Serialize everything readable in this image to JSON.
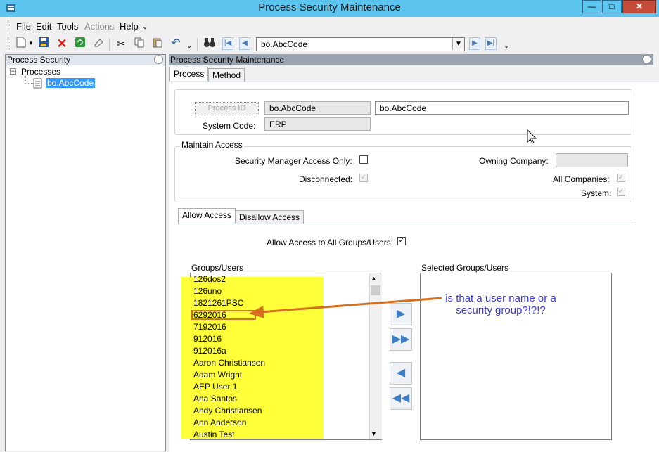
{
  "window": {
    "title": "Process Security Maintenance",
    "controls": {
      "minimize": "—",
      "maximize": "□",
      "close": "✕"
    }
  },
  "menu": {
    "items": [
      {
        "label": "File"
      },
      {
        "label": "Edit"
      },
      {
        "label": "Tools"
      },
      {
        "label": "Actions",
        "disabled": true
      },
      {
        "label": "Help"
      }
    ]
  },
  "toolbar": {
    "record_value": "bo.AbcCode"
  },
  "left_panel": {
    "header": "Process Security",
    "tree": {
      "root": "Processes",
      "child": "bo.AbcCode"
    }
  },
  "right_panel": {
    "header": "Process Security Maintenance",
    "tabs": [
      "Process",
      "Method"
    ],
    "process_id": {
      "button": "Process ID",
      "value": "bo.AbcCode",
      "description": "bo.AbcCode"
    },
    "system_code": {
      "label": "System Code:",
      "value": "ERP"
    },
    "maintain_access": {
      "title": "Maintain Access",
      "security_manager_label": "Security Manager Access Only:",
      "disconnected_label": "Disconnected:",
      "owning_company_label": "Owning Company:",
      "all_companies_label": "All Companies:",
      "system_label": "System:"
    },
    "access_tabs": [
      "Allow Access",
      "Disallow Access"
    ],
    "allow_all_label": "Allow Access to All Groups/Users:",
    "groups_label": "Groups/Users",
    "selected_label": "Selected Groups/Users",
    "groups": [
      "126dos2",
      "126uno",
      "1821261PSC",
      "6292016",
      "7192016",
      "912016",
      "912016a",
      "Aaron Christiansen",
      "Adam Wright",
      "AEP User 1",
      "Ana Santos",
      "Andy Christiansen",
      "Ann Anderson",
      "Austin Test"
    ]
  },
  "annotation": {
    "text_line1": "is that a user name or a",
    "text_line2": "security group?!?!?",
    "color": "#3b3ae0",
    "arrow_color": "#d5701e"
  },
  "colors": {
    "titlebar": "#5bc5f0",
    "highlight": "#ffff3a",
    "selected_tree": "#3399ff"
  }
}
